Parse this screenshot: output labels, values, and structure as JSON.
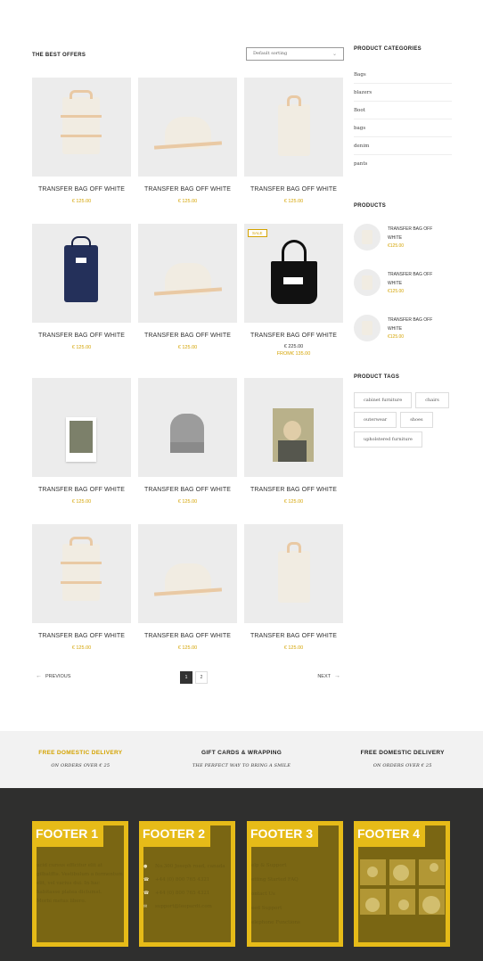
{
  "shop": {
    "title": "THE BEST OFFERS",
    "sort_value": "Default sorting",
    "products": [
      {
        "title": "TRANSFER BAG OFF WHITE",
        "price": "€ 125.00",
        "image": "cream-backpack"
      },
      {
        "title": "TRANSFER BAG OFF WHITE",
        "price": "€ 125.00",
        "image": "cream-bag-side"
      },
      {
        "title": "TRANSFER BAG OFF WHITE",
        "price": "€ 125.00",
        "image": "cream-tote"
      },
      {
        "title": "TRANSFER BAG OFF WHITE",
        "price": "€ 125.00",
        "image": "navy-backpack"
      },
      {
        "title": "TRANSFER BAG OFF WHITE",
        "price": "€ 125.00",
        "image": "cream-bag-side"
      },
      {
        "title": "TRANSFER BAG OFF WHITE",
        "badge": "SALE",
        "price": "€ 225.00",
        "price_from": "FROM€ 135.00",
        "image": "black-tote"
      },
      {
        "title": "TRANSFER BAG OFF WHITE",
        "price": "€ 125.00",
        "image": "postcard"
      },
      {
        "title": "TRANSFER BAG OFF WHITE",
        "price": "€ 125.00",
        "image": "grey-beanie"
      },
      {
        "title": "TRANSFER BAG OFF WHITE",
        "price": "€ 125.00",
        "image": "photo-print"
      },
      {
        "title": "TRANSFER BAG OFF WHITE",
        "price": "€ 125.00",
        "image": "cream-backpack"
      },
      {
        "title": "TRANSFER BAG OFF WHITE",
        "price": "€ 125.00",
        "image": "cream-bag-side"
      },
      {
        "title": "TRANSFER BAG OFF WHITE",
        "price": "€ 125.00",
        "image": "cream-tote"
      }
    ]
  },
  "pagination": {
    "prev": "PREVIOUS",
    "next": "NEXT",
    "pages": [
      "1",
      "2"
    ],
    "current": "1"
  },
  "sidebar": {
    "categories_title": "PRODUCT CATEGORIES",
    "categories": [
      "Bags",
      "blazers",
      "Boot",
      "bags",
      "denim",
      "pants"
    ],
    "products_title": "PRODUCTS",
    "products": [
      {
        "name": "TRANSFER BAG OFF WHITE",
        "price": "€125.00"
      },
      {
        "name": "TRANSFER BAG OFF WHITE",
        "price": "€125.00"
      },
      {
        "name": "TRANSFER BAG OFF WHITE",
        "price": "€125.00"
      }
    ],
    "tags_title": "PRODUCT TAGS",
    "tags": [
      "cabinet furniture",
      "chairs",
      "outerwear",
      "shoes",
      "upholstered furniture"
    ]
  },
  "features": [
    {
      "title": "FREE DOMESTIC DELIVERY",
      "subtitle": "ON ORDERS OVER € 25"
    },
    {
      "title": "GIFT CARDS & WRAPPING",
      "subtitle": "THE PERFECT WAY TO BRING A SMILE"
    },
    {
      "title": "FREE DOMESTIC DELIVERY",
      "subtitle": "ON ORDERS OVER € 25"
    }
  ],
  "footer": {
    "col1": {
      "title": "FOOTER 1",
      "lines": [
        "ucid cursus efficitur elit at",
        "gilbatffis. Vestibulum a fermentum",
        "elit, vel varius dui. In hac",
        "habitasse platea dictumst.",
        "Morbi metus libero."
      ]
    },
    "col2": {
      "title": "FOOTER 2",
      "contacts": [
        {
          "icon": "location-icon",
          "text": "No.300 Joseph road, canada"
        },
        {
          "icon": "phone-icon",
          "text": "+44 (0) 800 765 4321"
        },
        {
          "icon": "phone-icon",
          "text": "+44 (0) 800 765 4321"
        },
        {
          "icon": "mail-icon",
          "text": "support@leopardt.com"
        }
      ]
    },
    "col3": {
      "title": "FOOTER 3",
      "links": [
        "elp & Support",
        "etting Started FAQ",
        "ontact Us",
        "eed Support",
        "elephone Functions"
      ]
    },
    "col4": {
      "title": "FOOTER 4",
      "images": [
        "lemon-image",
        "plates-image",
        "cup-image",
        "chairs-image",
        "bowl-image",
        "bicycle-image"
      ]
    }
  },
  "colors": {
    "accent": "#d4a300",
    "footer_bg": "#2f2f2e",
    "footer_box": "#7a6613",
    "footer_border": "#e6bb18"
  }
}
